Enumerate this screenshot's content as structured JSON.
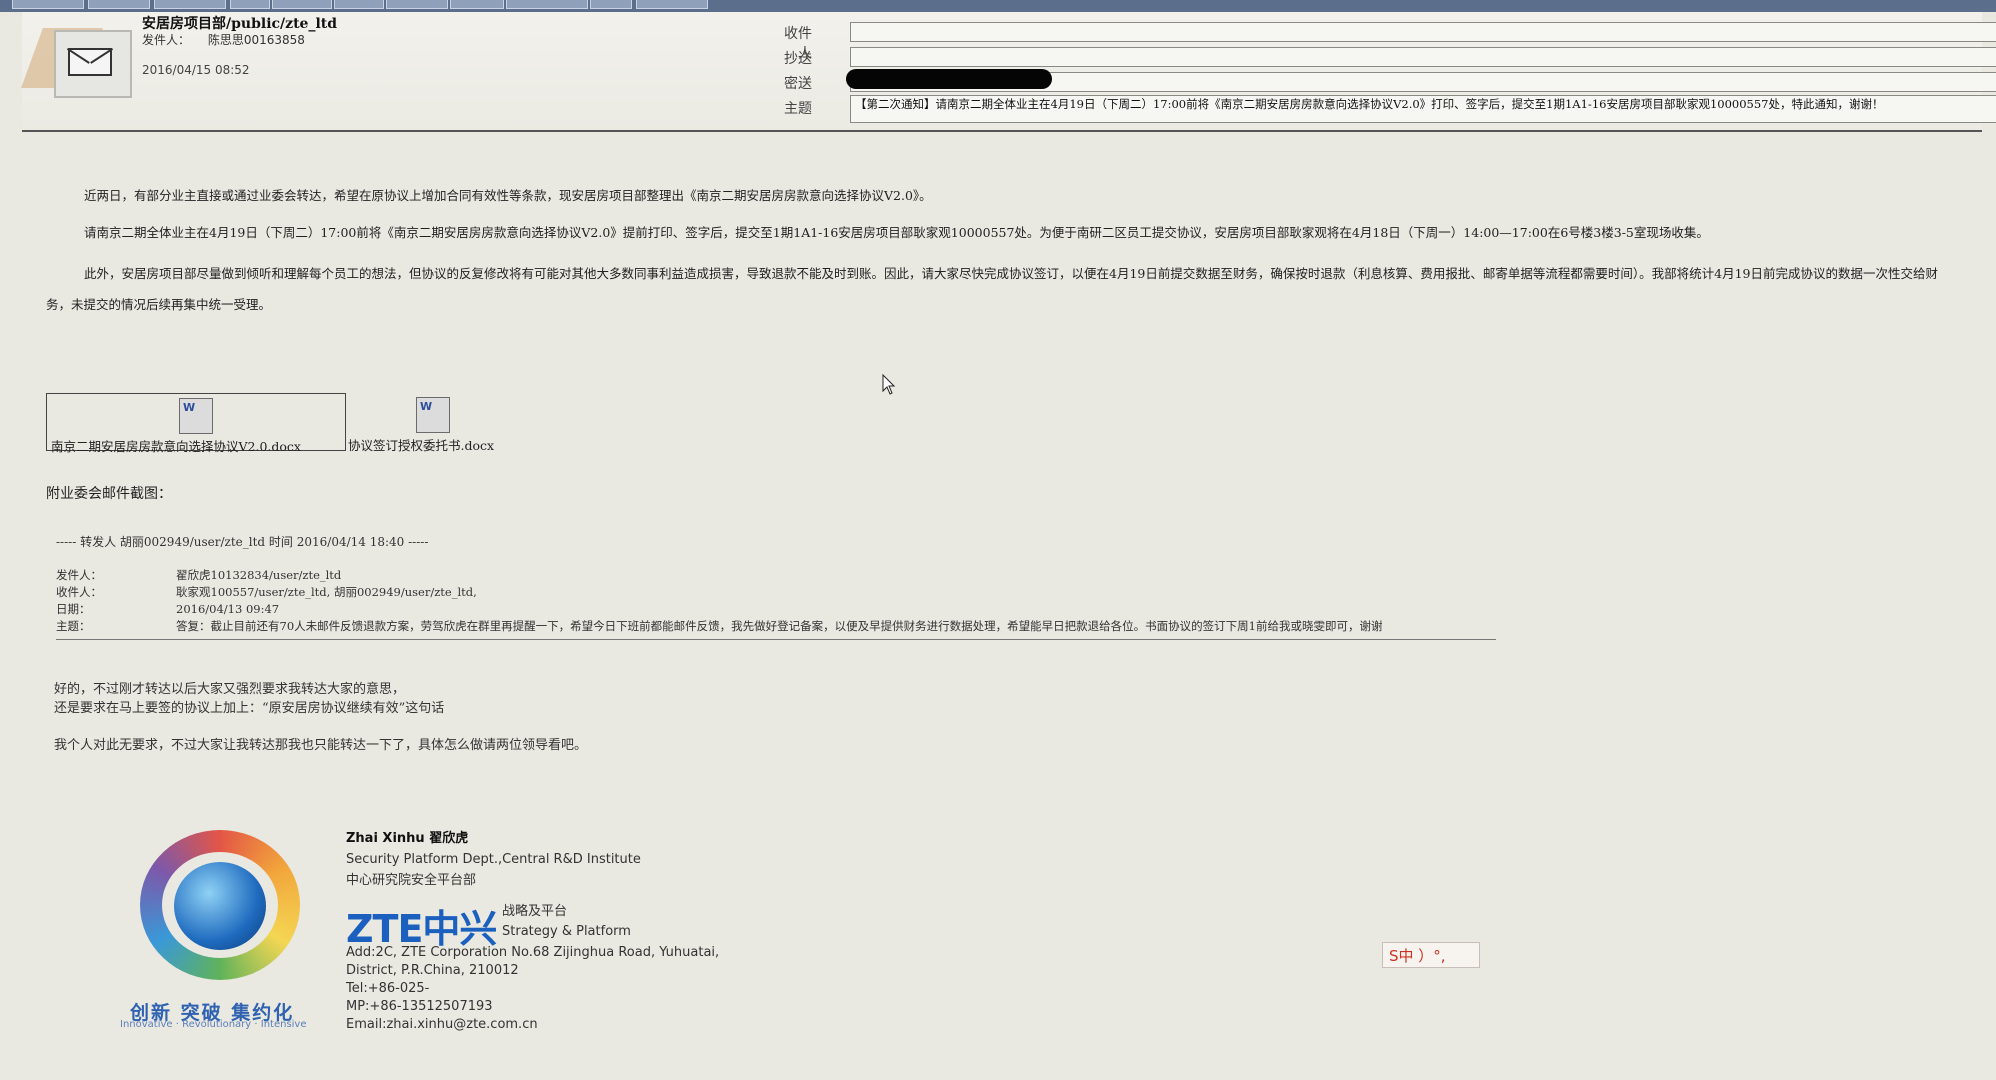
{
  "header": {
    "folder": "安居房项目部/public/zte_ltd",
    "from_label": "发件人：",
    "from_value": "陈思思00163858",
    "date": "2016/04/15 08:52",
    "labels": {
      "to": "收件人",
      "cc": "抄送",
      "bcc": "密送",
      "subject": "主题"
    },
    "subject": "【第二次通知】请南京二期全体业主在4月19日（下周二）17:00前将《南京二期安居房房款意向选择协议V2.0》打印、签字后，提交至1期1A1-16安居房项目部耿家观10000557处，特此通知，谢谢！"
  },
  "body": {
    "p1": "近两日，有部分业主直接或通过业委会转达，希望在原协议上增加合同有效性等条款，现安居房项目部整理出《南京二期安居房房款意向选择协议V2.0》。",
    "p2": "请南京二期全体业主在4月19日（下周二）17:00前将《南京二期安居房房款意向选择协议V2.0》提前打印、签字后，提交至1期1A1-16安居房项目部耿家观10000557处。为便于南研二区员工提交协议，安居房项目部耿家观将在4月18日（下周一）14:00—17:00在6号楼3楼3-5室现场收集。",
    "p3": "此外，安居房项目部尽量做到倾听和理解每个员工的想法，但协议的反复修改将有可能对其他大多数同事利益造成损害，导致退款不能及时到账。因此，请大家尽快完成协议签订，以便在4月19日前提交数据至财务，确保按时退款（利息核算、费用报批、邮寄单据等流程都需要时间）。我部将统计4月19日前完成协议的数据一次性交给财务，未提交的情况后续再集中统一受理。"
  },
  "attachments": [
    {
      "name": "南京二期安居房房款意向选择协议V2.0.docx"
    },
    {
      "name": "协议签订授权委托书.docx"
    }
  ],
  "appendix_label": "附业委会邮件截图：",
  "forward": {
    "header": "----- 转发人 胡丽002949/user/zte_ltd 时间 2016/04/14 18:40 -----",
    "from_label": "发件人：",
    "from_value": "翟欣虎10132834/user/zte_ltd",
    "to_label": "收件人：",
    "to_value": "耿家观100557/user/zte_ltd, 胡丽002949/user/zte_ltd,",
    "date_label": "日期：",
    "date_value": "2016/04/13 09:47",
    "subject_label": "主题：",
    "subject_value": "答复：截止目前还有70人未邮件反馈退款方案，劳驾欣虎在群里再提醒一下，希望今日下班前都能邮件反馈，我先做好登记备案，以便及早提供财务进行数据处理，希望能早日把款退给各位。书面协议的签订下周1前给我或晓雯即可，谢谢"
  },
  "reply": {
    "line1": "好的，不过刚才转达以后大家又强烈要求我转达大家的意思，",
    "line2": "还是要求在马上要签的协议上加上：“原安居房协议继续有效”这句话",
    "line3": "我个人对此无要求，不过大家让我转达那我也只能转达一下了，具体怎么做请两位领导看吧。"
  },
  "signature": {
    "name": "Zhai Xinhu 翟欣虎",
    "dept_en": "Security Platform Dept.,Central R&D Institute",
    "dept_cn": "中心研究院安全平台部",
    "brand": "ZTE中兴",
    "tag_cn": "战略及平台",
    "tag_en": "Strategy & Platform",
    "addr1": "Add:2C, ZTE Corporation No.68 Zijinghua Road, Yuhuatai,",
    "addr2": "District, P.R.China, 210012",
    "tel": "Tel:+86-025-",
    "mp": "MP:+86-13512507193",
    "email": "Email:zhai.xinhu@zte.com.cn",
    "slogan_cn": "创新 突破 集约化",
    "slogan_en": "Innovative · Revolutionary · Intensive"
  },
  "ime": {
    "label": "S中 ）°,"
  },
  "colors": {
    "brand": "#1b5fbf",
    "ime_red": "#d0301f"
  }
}
